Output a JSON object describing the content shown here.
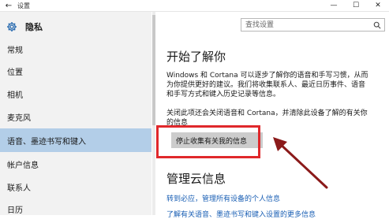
{
  "titlebar": {
    "title": "设置",
    "back_icon": "back-arrow-icon",
    "minimize": "—",
    "maximize": "☐",
    "close": "✕"
  },
  "sidebar": {
    "header_icon": "gear-icon",
    "title": "隐私",
    "items": [
      {
        "label": "常规"
      },
      {
        "label": "位置"
      },
      {
        "label": "相机"
      },
      {
        "label": "麦克风"
      },
      {
        "label": "语音、墨迹书写和键入",
        "active": true
      },
      {
        "label": "帐户信息"
      },
      {
        "label": "联系人"
      },
      {
        "label": "日历"
      }
    ]
  },
  "search": {
    "placeholder": "查找设置",
    "icon": "search-icon"
  },
  "main": {
    "section1_title": "开始了解你",
    "description_lines": [
      "Windows 和 Cortana 可以逐步了解你的语音和手写习惯，从而",
      "为你提供更好的建议。我们将收集联系人、最近日历事件、语音",
      "和手写方式和键入历史记录等信息。"
    ],
    "turn_off_lines": [
      "关闭此项还会关闭语音和 Cortana，并清除此设备了解的有关你",
      "的信息"
    ],
    "stop_button_label": "停止收集有关我的信息",
    "section2_title": "管理云信息",
    "link1": "转到必应，管理所有设备的个人信息",
    "link2": "了解有关语音、墨迹书写和键入设置的更多信息"
  },
  "colors": {
    "sidebar_bg": "#f2f2f2",
    "active_item": "#b3cee8",
    "highlight_box": "#e0282b",
    "annotation_arrow": "#8b1a1a",
    "link": "#1a5fb4"
  }
}
